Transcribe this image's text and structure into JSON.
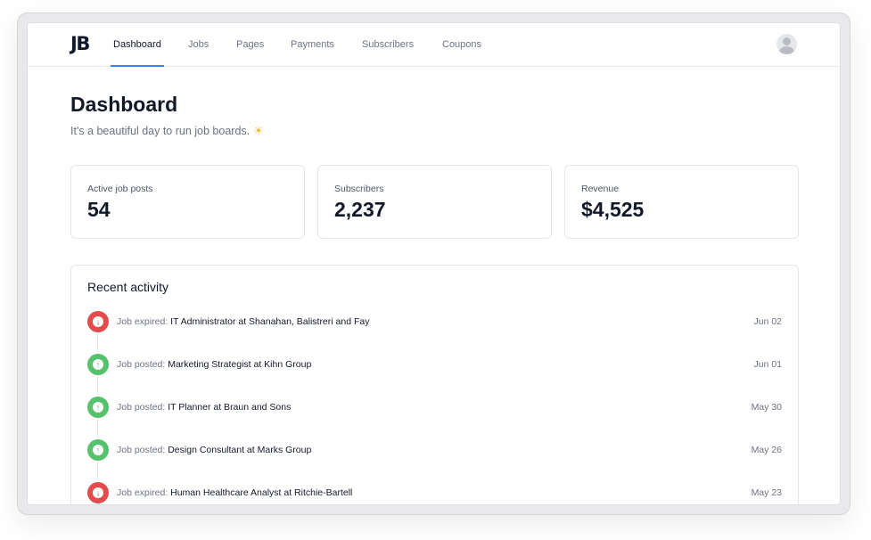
{
  "brand": {
    "logo": "JB"
  },
  "nav": {
    "items": [
      {
        "label": "Dashboard",
        "active": true
      },
      {
        "label": "Jobs"
      },
      {
        "label": "Pages"
      },
      {
        "label": "Payments"
      },
      {
        "label": "Subscribers"
      },
      {
        "label": "Coupons"
      }
    ],
    "avatar_icon": "user-avatar-icon"
  },
  "page": {
    "title": "Dashboard",
    "subtitle": "It's a beautiful day to run job boards.",
    "subtitle_icon": "sun-icon"
  },
  "stats": [
    {
      "label": "Active job posts",
      "value": "54"
    },
    {
      "label": "Subscribers",
      "value": "2,237"
    },
    {
      "label": "Revenue",
      "value": "$4,525"
    }
  ],
  "activity": {
    "title": "Recent activity",
    "items": [
      {
        "status": "expired",
        "icon": "arrow-down-icon",
        "type": "Job expired:",
        "subject": "IT Administrator at Shanahan, Balistreri and Fay",
        "date": "Jun 02"
      },
      {
        "status": "posted",
        "icon": "arrow-up-icon",
        "type": "Job posted:",
        "subject": "Marketing Strategist at Kihn Group",
        "date": "Jun 01"
      },
      {
        "status": "posted",
        "icon": "arrow-up-icon",
        "type": "Job posted:",
        "subject": "IT Planner at Braun and Sons",
        "date": "May 30"
      },
      {
        "status": "posted",
        "icon": "arrow-up-icon",
        "type": "Job posted:",
        "subject": "Design Consultant at Marks Group",
        "date": "May 26"
      },
      {
        "status": "expired",
        "icon": "arrow-down-icon",
        "type": "Job expired:",
        "subject": "Human Healthcare Analyst at Ritchie-Bartell",
        "date": "May 23"
      }
    ]
  },
  "colors": {
    "accent": "#3b82f6",
    "expired": "#e34c4c",
    "posted": "#56c26b"
  }
}
